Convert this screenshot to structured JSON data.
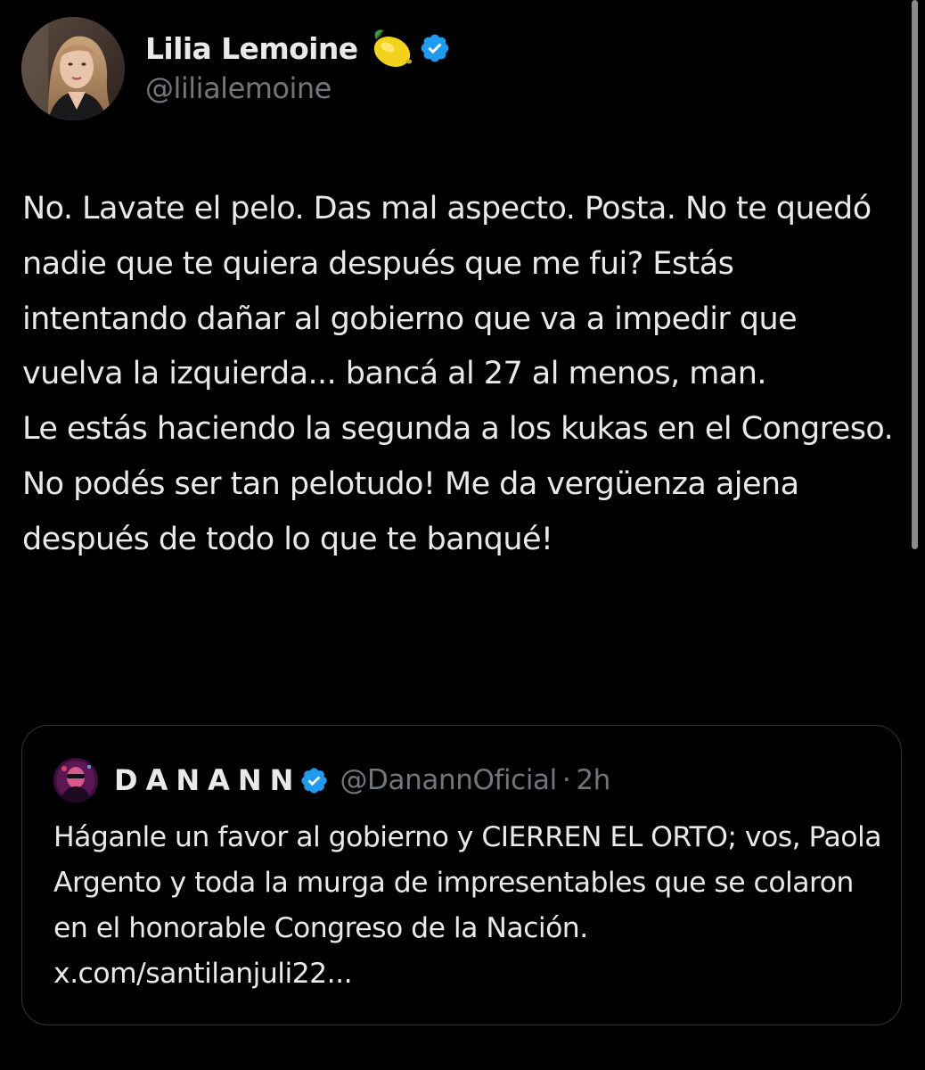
{
  "author": {
    "name": "Lilia Lemoine",
    "handle": "@lilialemoine",
    "emoji_icon": "lemon-emoji",
    "verified_icon": "verified-badge-icon",
    "verified_color": "#1d9bf0"
  },
  "tweet": {
    "text": "No. Lavate el pelo. Das mal aspecto. Posta. No te quedó nadie que te quiera después que me fui? Estás intentando dañar al gobierno que va a impedir que vuelva la izquierda... bancá al 27 al menos, man.\nLe estás haciendo la segunda a los kukas en el Congreso. No podés ser tan pelotudo! Me da vergüenza ajena después de todo lo que te banqué!"
  },
  "quote": {
    "name": "DANANN",
    "handle": "@DanannOficial",
    "separator": "·",
    "time": "2h",
    "text": "Háganle un favor al gobierno y CIERREN EL ORTO; vos, Paola Argento y toda la murga de impresentables que se colaron en el honorable Congreso de la Nación. ",
    "link": "x.com/santilanjuli22..."
  },
  "colors": {
    "background": "#000000",
    "text": "#e7e9ea",
    "secondary_text": "#71767b",
    "border": "#2f3336",
    "verified": "#1d9bf0"
  }
}
